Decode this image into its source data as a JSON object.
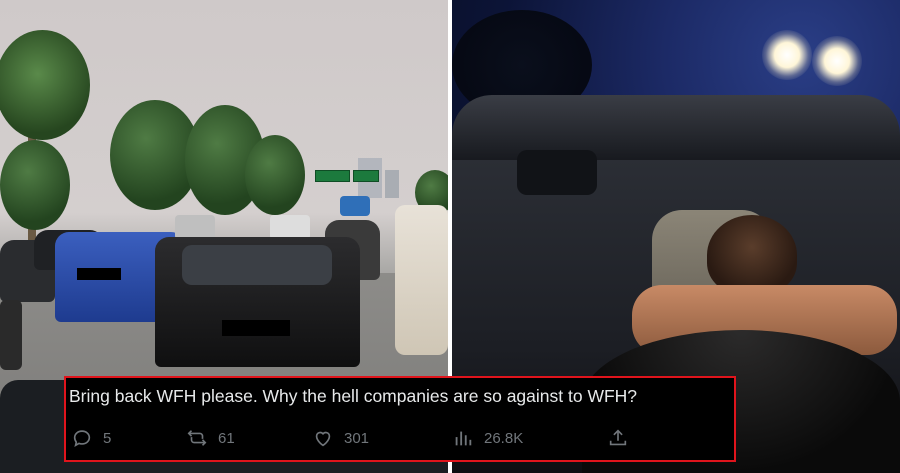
{
  "tweet": {
    "text": "Bring back WFH please. Why the hell companies are so against to WFH?",
    "actions": {
      "reply": {
        "icon": "reply-icon",
        "count": "5"
      },
      "repost": {
        "icon": "repost-icon",
        "count": "61"
      },
      "like": {
        "icon": "heart-icon",
        "count": "301"
      },
      "views": {
        "icon": "views-icon",
        "count": "26.8K"
      },
      "share": {
        "icon": "share-icon"
      }
    },
    "highlight_color": "#e0141c",
    "text_color": "#e7e9ea",
    "muted_color": "#71767b"
  }
}
